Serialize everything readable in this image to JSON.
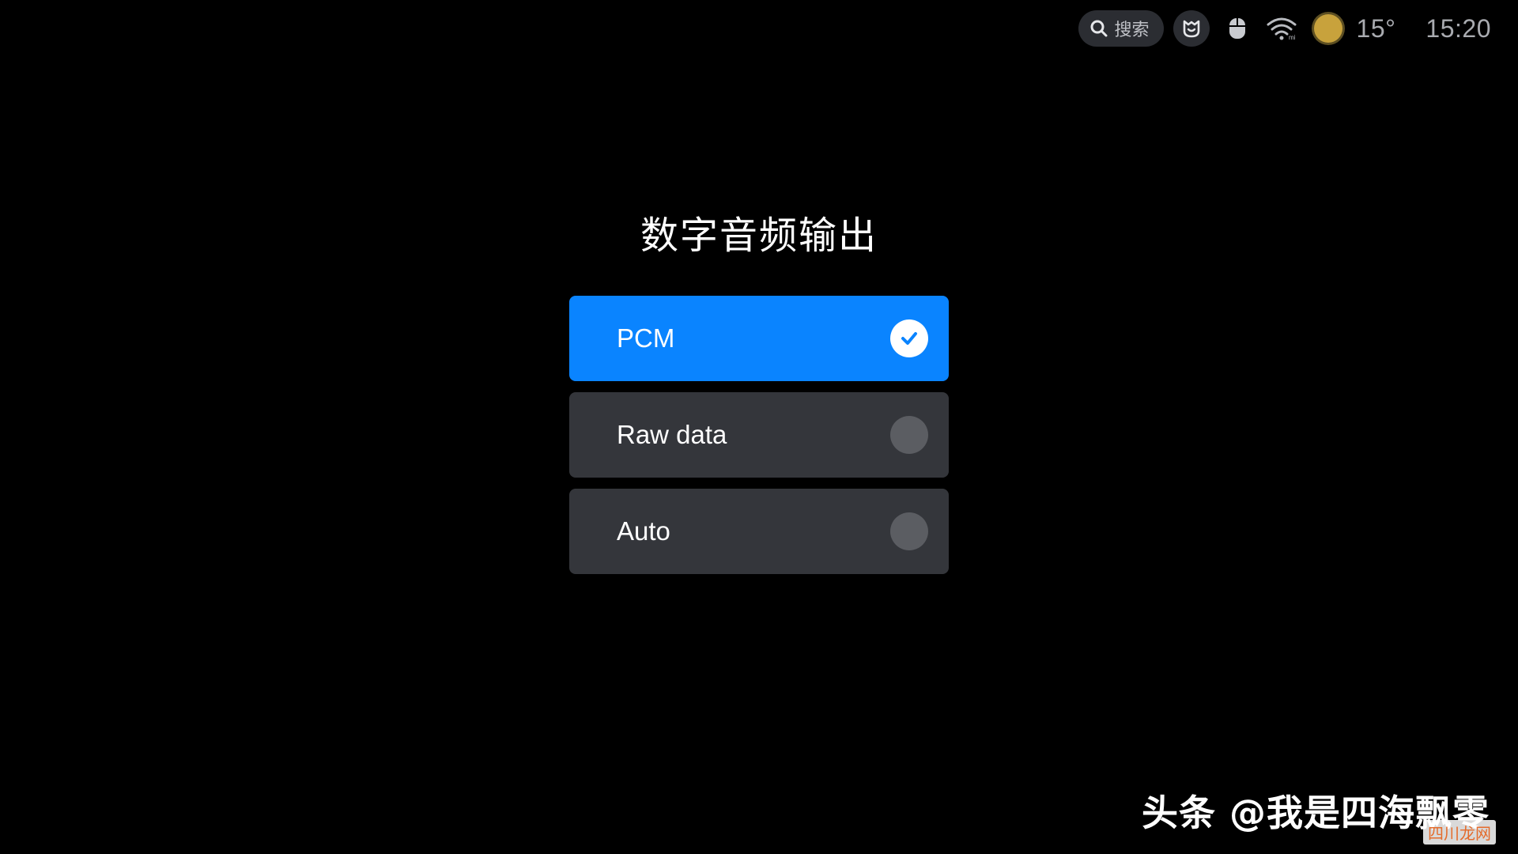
{
  "status_bar": {
    "search_label": "搜索",
    "icons": [
      "search-icon",
      "mi-home-icon",
      "mouse-icon",
      "wifi-icon",
      "weather-sun-icon"
    ],
    "temperature": "15°",
    "time": "15:20"
  },
  "dialog": {
    "title": "数字音频输出",
    "options": [
      {
        "label": "PCM",
        "selected": true
      },
      {
        "label": "Raw data",
        "selected": false
      },
      {
        "label": "Auto",
        "selected": false
      }
    ]
  },
  "watermark": {
    "text": "头条 @我是四海飘零",
    "corner_text": "四川龙网"
  },
  "colors": {
    "accent": "#0a84ff",
    "option_bg": "#34363b",
    "radio_off": "#5b5d62",
    "weather": "#c8a23c"
  }
}
